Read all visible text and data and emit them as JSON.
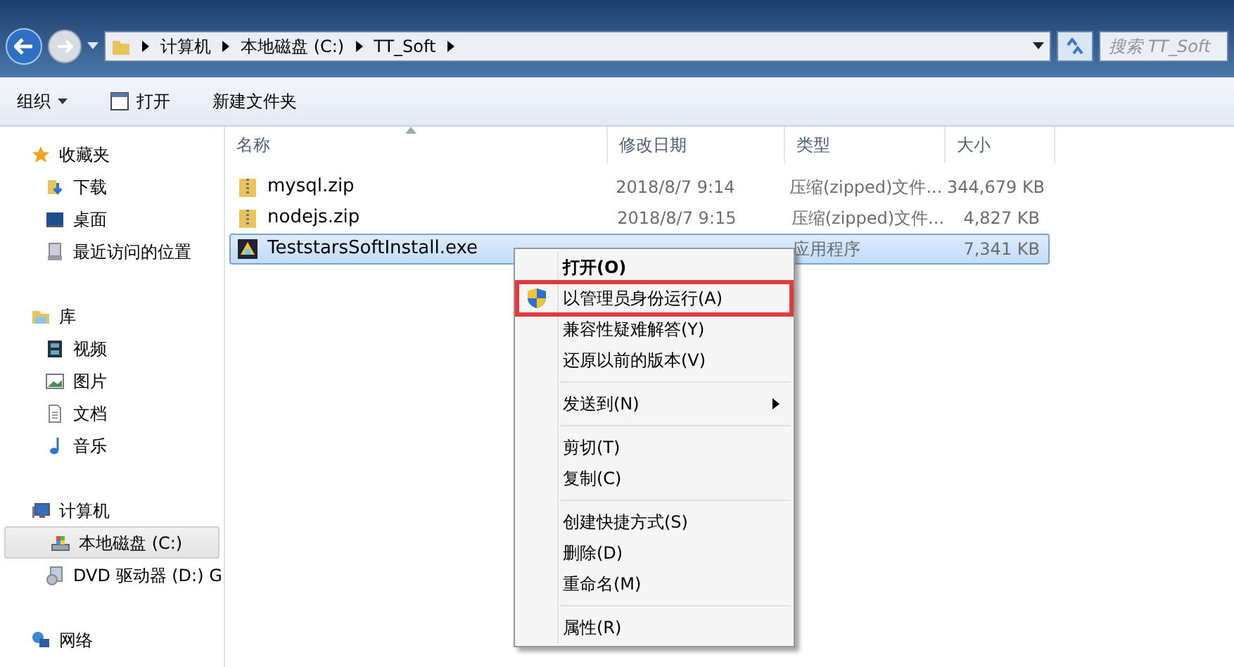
{
  "address_bar": {
    "path": [
      "计算机",
      "本地磁盘 (C:)",
      "TT_Soft"
    ]
  },
  "search": {
    "placeholder": "搜索 TT_Soft"
  },
  "toolbar": [
    "组织",
    "打开",
    "新建文件夹"
  ],
  "sidebar": {
    "groups": [
      {
        "label": "收藏夹",
        "children": [
          {
            "label": "下载",
            "selected": false
          },
          {
            "label": "桌面",
            "selected": false
          },
          {
            "label": "最近访问的位置",
            "selected": false
          }
        ]
      },
      {
        "label": "库",
        "children": [
          {
            "label": "视频",
            "selected": false
          },
          {
            "label": "图片",
            "selected": false
          },
          {
            "label": "文档",
            "selected": false
          },
          {
            "label": "音乐",
            "selected": false
          }
        ]
      },
      {
        "label": "计算机",
        "children": [
          {
            "label": "本地磁盘 (C:)",
            "selected": true
          },
          {
            "label": "DVD 驱动器 (D:) G",
            "selected": false
          }
        ]
      },
      {
        "label": "网络"
      }
    ]
  },
  "table": {
    "columns": [
      "名称",
      "修改日期",
      "类型",
      "大小"
    ],
    "rows": [
      {
        "kind": "zip",
        "name": "mysql.zip",
        "date": "2018/8/7 9:14",
        "type": "压缩(zipped)文件...",
        "size": "344,679 KB",
        "selected": false
      },
      {
        "kind": "zip",
        "name": "nodejs.zip",
        "date": "2018/8/7 9:15",
        "type": "压缩(zipped)文件...",
        "size": "4,827 KB",
        "selected": false
      },
      {
        "kind": "program",
        "name": "TeststarsSoftInstall.exe",
        "type": "应用程序",
        "size": "7,341 KB",
        "selected": true
      }
    ]
  },
  "context_menu": [
    {
      "kind": "item",
      "label": "打开(O)",
      "bold": true,
      "highlighted": false
    },
    {
      "kind": "item",
      "label": "以管理员身份运行(A)",
      "shield": true,
      "highlighted": true
    },
    {
      "kind": "item",
      "label": "兼容性疑难解答(Y)",
      "highlighted": false
    },
    {
      "kind": "item",
      "label": "还原以前的版本(V)",
      "highlighted": false
    },
    {
      "kind": "separator"
    },
    {
      "kind": "item",
      "label": "发送到(N)",
      "submenu": true,
      "highlighted": false
    },
    {
      "kind": "separator"
    },
    {
      "kind": "item",
      "label": "剪切(T)",
      "highlighted": false
    },
    {
      "kind": "item",
      "label": "复制(C)",
      "highlighted": false
    },
    {
      "kind": "separator"
    },
    {
      "kind": "item",
      "label": "创建快捷方式(S)",
      "highlighted": false
    },
    {
      "kind": "item",
      "label": "删除(D)",
      "highlighted": false
    },
    {
      "kind": "item",
      "label": "重命名(M)",
      "highlighted": false
    },
    {
      "kind": "separator"
    },
    {
      "kind": "item",
      "label": "属性(R)",
      "highlighted": false
    }
  ]
}
